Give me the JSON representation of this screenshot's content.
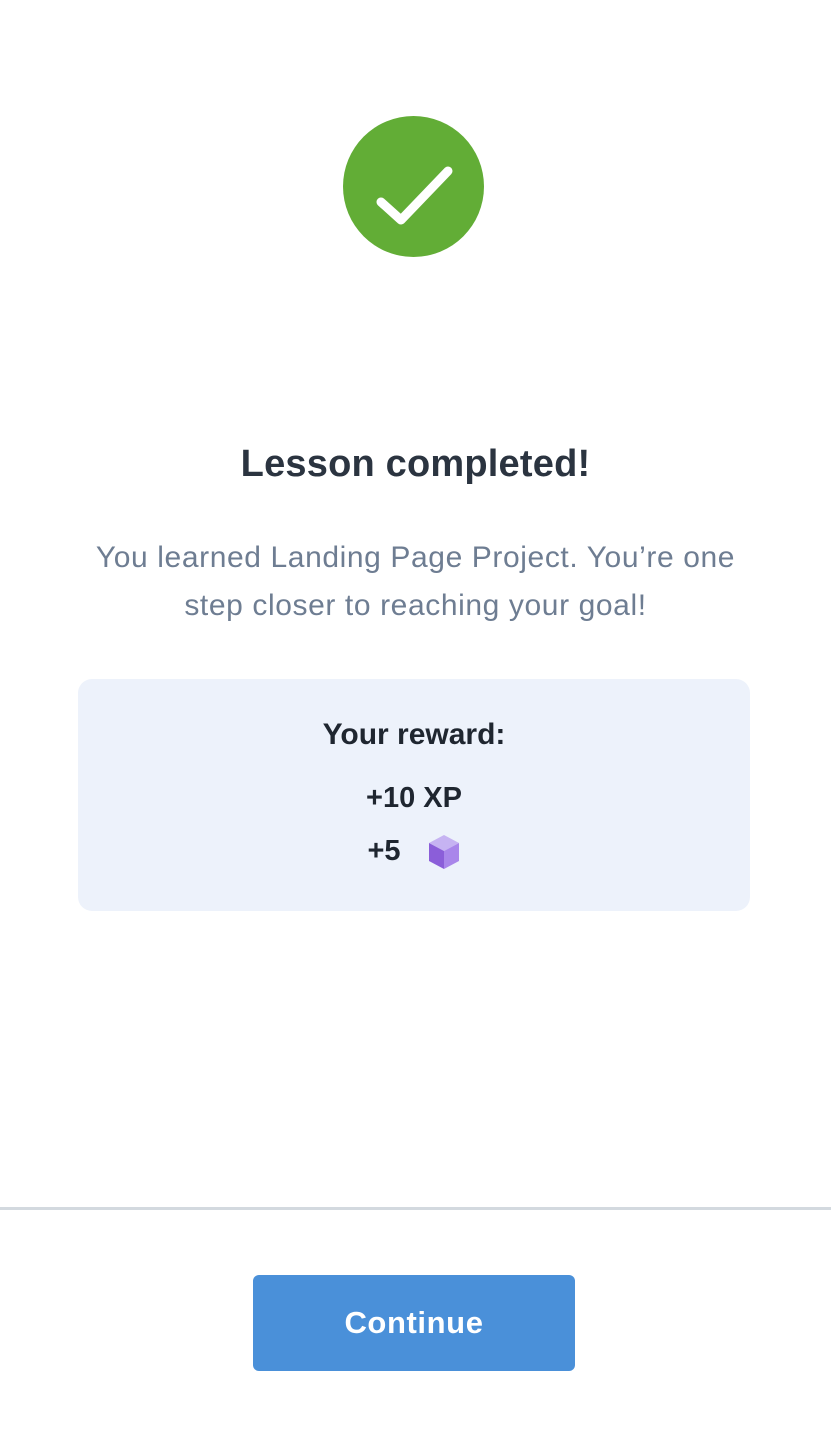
{
  "status": {
    "icon": "check-circle-icon",
    "color": "#62ad36"
  },
  "title": "Lesson completed!",
  "message": "You learned Landing Page Project. You’re one step closer to reaching your goal!",
  "reward": {
    "heading": "Your reward:",
    "xp": "+10 XP",
    "gems": "+5",
    "gem_icon": "gem-cube-icon",
    "gem_color": "#8b5ed9"
  },
  "continue_label": "Continue",
  "accent_color": "#4a90d9"
}
